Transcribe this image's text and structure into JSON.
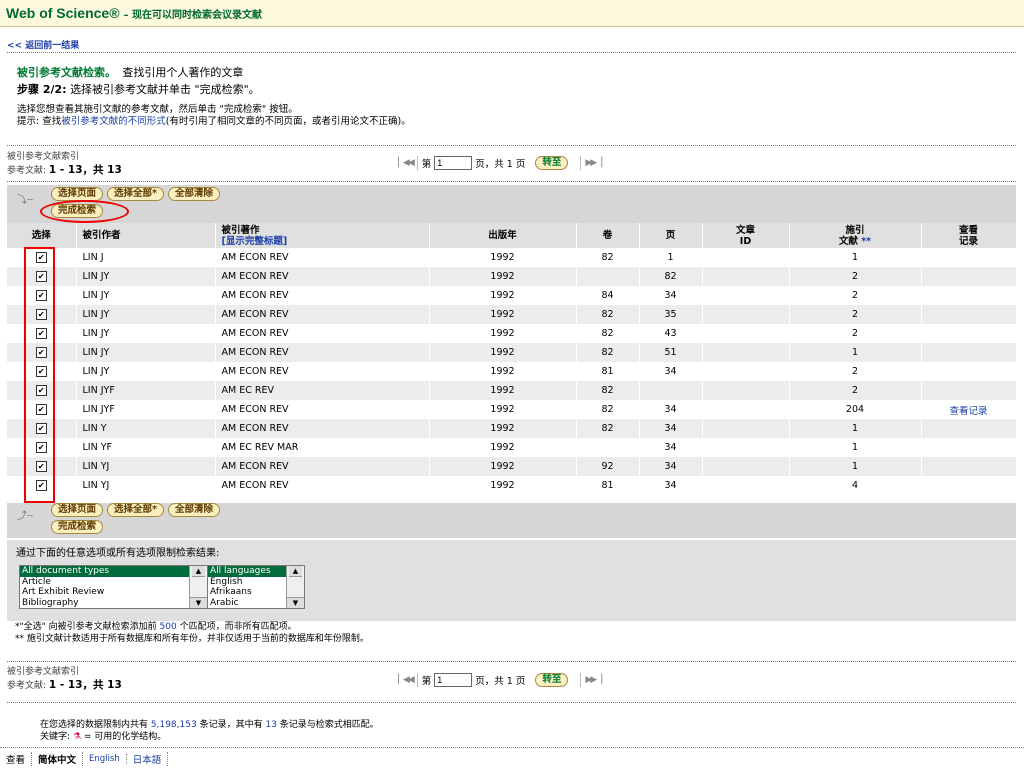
{
  "header": {
    "brand": "Web of Science®",
    "subtitle": "– 现在可以同时检索会议录文献"
  },
  "nav": {
    "back_label": "<< 返回前一结果"
  },
  "intro": {
    "title_bold": "被引参考文献检索。",
    "title_rest": "查找引用个人著作的文章",
    "step_bold": "步骤 2/2:",
    "step_rest": "选择被引参考文献并单击 \"完成检索\"。",
    "line1": "选择您想查看其施引文献的参考文献，然后单击 \"完成检索\" 按钮。",
    "hint_prefix": "提示: 查找",
    "hint_link": "被引参考文献的不同形式",
    "hint_suffix": "(有时引用了相同文章的不同页面，或者引用论文不正确)。"
  },
  "index_info": {
    "label": "被引参考文献索引",
    "count_prefix": "参考文献:",
    "count_value": "1 - 13，共 13"
  },
  "pager": {
    "page_prefix": "第",
    "page_value": "1",
    "page_suffix": "页，共 1 页",
    "goto_label": "转至"
  },
  "actions": {
    "select_page": "选择页面",
    "select_all": "选择全部*",
    "clear_all": "全部清除",
    "finish": "完成检索"
  },
  "table": {
    "headers": {
      "select": "选择",
      "author": "被引作者",
      "work": "被引著作",
      "work_link": "[显示完整标题]",
      "year": "出版年",
      "volume": "卷",
      "page": "页",
      "article_id_1": "文章",
      "article_id_2": "ID",
      "citing_1": "施引",
      "citing_2": "文献",
      "citing_mark": "**",
      "view_1": "查看",
      "view_2": "记录"
    },
    "rows": [
      {
        "checked": "✔",
        "author": "LIN J",
        "work": "AM ECON REV",
        "year": "1992",
        "volume": "82",
        "page": "1",
        "article_id": "",
        "citing": "1",
        "view": ""
      },
      {
        "checked": "✔",
        "author": "LIN JY",
        "work": "AM ECON REV",
        "year": "1992",
        "volume": "",
        "page": "82",
        "article_id": "",
        "citing": "2",
        "view": ""
      },
      {
        "checked": "✔",
        "author": "LIN JY",
        "work": "AM ECON REV",
        "year": "1992",
        "volume": "84",
        "page": "34",
        "article_id": "",
        "citing": "2",
        "view": ""
      },
      {
        "checked": "✔",
        "author": "LIN JY",
        "work": "AM ECON REV",
        "year": "1992",
        "volume": "82",
        "page": "35",
        "article_id": "",
        "citing": "2",
        "view": ""
      },
      {
        "checked": "✔",
        "author": "LIN JY",
        "work": "AM ECON REV",
        "year": "1992",
        "volume": "82",
        "page": "43",
        "article_id": "",
        "citing": "2",
        "view": ""
      },
      {
        "checked": "✔",
        "author": "LIN JY",
        "work": "AM ECON REV",
        "year": "1992",
        "volume": "82",
        "page": "51",
        "article_id": "",
        "citing": "1",
        "view": ""
      },
      {
        "checked": "✔",
        "author": "LIN JY",
        "work": "AM ECON REV",
        "year": "1992",
        "volume": "81",
        "page": "34",
        "article_id": "",
        "citing": "2",
        "view": ""
      },
      {
        "checked": "✔",
        "author": "LIN JYF",
        "work": "AM EC REV",
        "year": "1992",
        "volume": "82",
        "page": "",
        "article_id": "",
        "citing": "2",
        "view": ""
      },
      {
        "checked": "✔",
        "author": "LIN JYF",
        "work": "AM ECON REV",
        "year": "1992",
        "volume": "82",
        "page": "34",
        "article_id": "",
        "citing": "204",
        "view": "查看记录"
      },
      {
        "checked": "✔",
        "author": "LIN Y",
        "work": "AM ECON REV",
        "year": "1992",
        "volume": "82",
        "page": "34",
        "article_id": "",
        "citing": "1",
        "view": ""
      },
      {
        "checked": "✔",
        "author": "LIN YF",
        "work": "AM EC REV MAR",
        "year": "1992",
        "volume": "",
        "page": "34",
        "article_id": "",
        "citing": "1",
        "view": ""
      },
      {
        "checked": "✔",
        "author": "LIN YJ",
        "work": "AM ECON REV",
        "year": "1992",
        "volume": "92",
        "page": "34",
        "article_id": "",
        "citing": "1",
        "view": ""
      },
      {
        "checked": "✔",
        "author": "LIN YJ",
        "work": "AM ECON REV",
        "year": "1992",
        "volume": "81",
        "page": "34",
        "article_id": "",
        "citing": "4",
        "view": ""
      }
    ]
  },
  "limit": {
    "label": "通过下面的任意选项或所有选项限制检索结果:",
    "doc_types": [
      "All document types",
      "Article",
      "Art Exhibit Review",
      "Bibliography"
    ],
    "languages": [
      "All languages",
      "English",
      "Afrikaans",
      "Arabic"
    ]
  },
  "notes": {
    "n1_prefix": "*\"全选\" 向被引参考文献检索添加前",
    "n1_num": "500",
    "n1_suffix": "个匹配项，而非所有匹配项。",
    "n2": "** 施引文献计数适用于所有数据库和所有年份，并非仅适用于当前的数据库和年份限制。"
  },
  "footer": {
    "f1_prefix": "在您选择的数据限制内共有",
    "f1_total": "5,198,153",
    "f1_mid": "条记录，其中有",
    "f1_match": "13",
    "f1_suffix": "条记录与检索式相匹配。",
    "f2_prefix": "关键字:",
    "f2_suffix": "= 可用的化学结构。"
  },
  "langbar": [
    "查看",
    "简体中文",
    "English",
    "日本語"
  ]
}
